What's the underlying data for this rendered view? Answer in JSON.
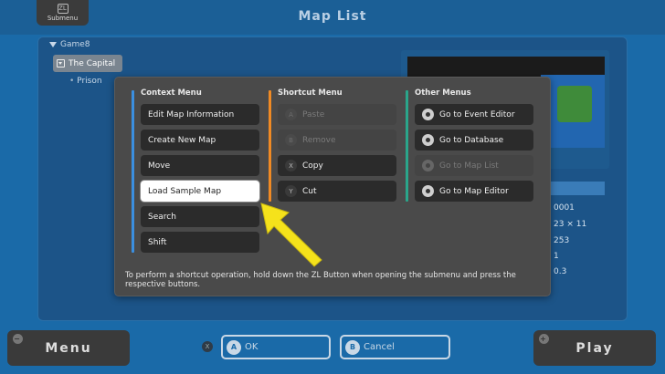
{
  "topbar": {
    "submenu_glyph": "ZL",
    "submenu_label": "Submenu",
    "title": "Map List"
  },
  "tree": {
    "root": "Game8",
    "items": [
      "The Capital",
      "Prison"
    ]
  },
  "map_info_values": [
    "0001",
    "23 × 11",
    "253",
    "1",
    "0.3"
  ],
  "dialog": {
    "context": {
      "heading": "Context Menu",
      "items": [
        "Edit Map Information",
        "Create New Map",
        "Move",
        "Load Sample Map",
        "Search",
        "Shift"
      ]
    },
    "shortcut": {
      "heading": "Shortcut Menu",
      "items": [
        {
          "key": "A",
          "label": "Paste"
        },
        {
          "key": "B",
          "label": "Remove"
        },
        {
          "key": "X",
          "label": "Copy"
        },
        {
          "key": "Y",
          "label": "Cut"
        }
      ]
    },
    "other": {
      "heading": "Other Menus",
      "items": [
        "Go to Event Editor",
        "Go to Database",
        "Go to Map List",
        "Go to Map Editor"
      ]
    },
    "hint": "To perform a shortcut operation, hold down the ZL Button when opening the submenu and press the respective buttons."
  },
  "bottom": {
    "menu_label": "Menu",
    "menu_corner": "−",
    "play_label": "Play",
    "play_corner": "+",
    "x_key": "X",
    "ok_key": "A",
    "ok_label": "OK",
    "cancel_key": "B",
    "cancel_label": "Cancel"
  },
  "colors": {
    "background": "#1a6aa8",
    "context_accent": "#3b8fe0",
    "shortcut_accent": "#f08a24",
    "other_accent": "#2aa58a",
    "arrow": "#f5e21b"
  }
}
